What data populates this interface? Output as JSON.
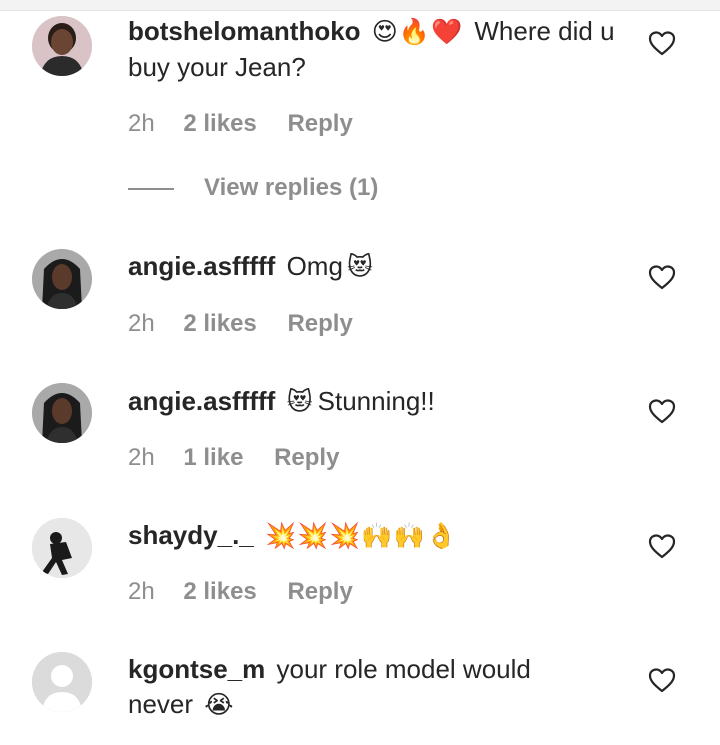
{
  "comments": [
    {
      "username": "botshelomanthoko",
      "emojis_before": "😍🔥❤️",
      "message": "Where did u buy your Jean?",
      "time": "2h",
      "likes": "2 likes",
      "reply": "Reply",
      "view_replies": "View replies (1)",
      "avatar_colors": {
        "bg": "#d9c3c6",
        "skin": "#6b4534",
        "hair": "#2a1c17",
        "shirt": "#2b2b2b"
      }
    },
    {
      "username": "angie.asfffff",
      "message": "Omg",
      "emojis_after": "😻",
      "time": "2h",
      "likes": "2 likes",
      "reply": "Reply",
      "avatar_colors": {
        "bg": "#a9a9a9",
        "skin": "#5a3a2a",
        "hair": "#1b1b1b",
        "shirt": "#2f2f2f"
      }
    },
    {
      "username": "angie.asfffff",
      "emojis_before": "😻",
      "message": "Stunning!!",
      "time": "2h",
      "likes": "1 like",
      "reply": "Reply",
      "avatar_colors": {
        "bg": "#a9a9a9",
        "skin": "#5a3a2a",
        "hair": "#1b1b1b",
        "shirt": "#2f2f2f"
      }
    },
    {
      "username": "shaydy_._",
      "emojis_after": "💥💥💥🙌🙌👌",
      "time": "2h",
      "likes": "2 likes",
      "reply": "Reply",
      "avatar_colors": {
        "bg": "#e7e7e7",
        "figure": "#1a1a1a"
      }
    },
    {
      "username": "kgontse_m",
      "message": "your role model would never",
      "emojis_after": "😭",
      "avatar_colors": {
        "bg": "#dbdbdb",
        "figure": "#ffffff"
      }
    }
  ],
  "icons": {
    "like": "heart-outline-icon"
  },
  "colors": {
    "text": "#262626",
    "secondary": "#8e8e8e"
  }
}
